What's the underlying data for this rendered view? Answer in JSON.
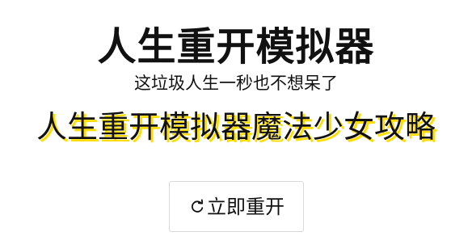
{
  "header": {
    "title": "人生重开模拟器",
    "subtitle": "这垃圾人生一秒也不想呆了"
  },
  "guide": {
    "title": "人生重开模拟器魔法少女攻略",
    "shadow_color": "#ffdd00"
  },
  "actions": {
    "restart_label": "立即重开",
    "restart_icon": "restart-icon"
  }
}
